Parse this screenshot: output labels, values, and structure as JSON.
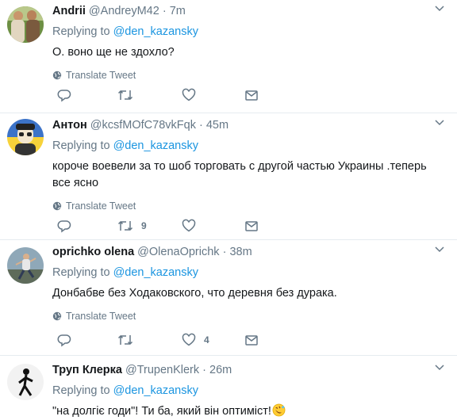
{
  "colors": {
    "text": "#14171a",
    "secondary": "#657786",
    "link": "#1b95e0",
    "divider": "#e6ecf0"
  },
  "tweets": [
    {
      "name": "Andrii",
      "handle": "@AndreyM42",
      "separator": "·",
      "time": "7m",
      "reply_prefix": "Replying to",
      "reply_to": "@den_kazansky",
      "text": "О. воно ще не здохло?",
      "translate": "Translate Tweet",
      "avatar_icon": "user-photo-couple",
      "retweets": "",
      "likes": ""
    },
    {
      "name": "Антон",
      "handle": "@kcsfMOfC78vkFqk",
      "separator": "·",
      "time": "45m",
      "reply_prefix": "Replying to",
      "reply_to": "@den_kazansky",
      "text": "короче воевели за то шоб торговать с другой частью Украины .теперь все ясно",
      "translate": "Translate Tweet",
      "avatar_icon": "cartoon-person-yellow-blue",
      "retweets": "9",
      "likes": ""
    },
    {
      "name": "oprichko olena",
      "handle": "@OlenaOprichk",
      "separator": "·",
      "time": "38m",
      "reply_prefix": "Replying to",
      "reply_to": "@den_kazansky",
      "text": "Донбабве без Ходаковского, что деревня без дурака.",
      "translate": "Translate Tweet",
      "avatar_icon": "runner-photo",
      "retweets": "",
      "likes": "4"
    },
    {
      "name": "Труп Клерка",
      "handle": "@TrupenKlerk",
      "separator": "·",
      "time": "26m",
      "reply_prefix": "Replying to",
      "reply_to": "@den_kazansky",
      "text": "\"на долгіє годи\"! Ти ба, який він оптиміст!",
      "emoji": "rolling-on-floor-laughing-emoji",
      "avatar_icon": "walking-figure-silhouette"
    }
  ]
}
